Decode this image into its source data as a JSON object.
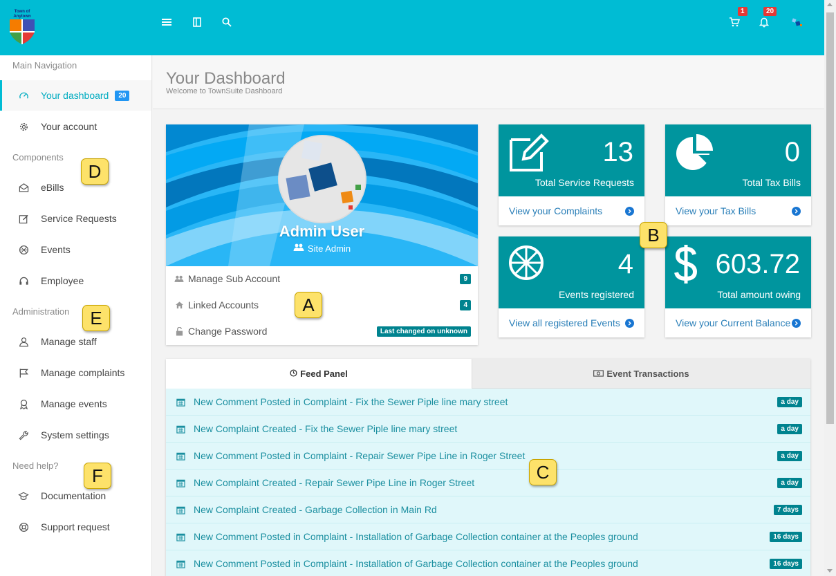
{
  "topbar": {
    "logo_text": "Town of Anytown",
    "cart_count": "1",
    "notification_count": "20"
  },
  "sidebar": {
    "sections": [
      {
        "heading": "Main Navigation",
        "items": [
          {
            "label": "Your dashboard",
            "badge": "20",
            "icon": "dashboard-icon",
            "active": true
          },
          {
            "label": "Your account",
            "icon": "gear-icon"
          }
        ]
      },
      {
        "heading": "Components",
        "items": [
          {
            "label": "eBills",
            "icon": "envelope-icon"
          },
          {
            "label": "Service Requests",
            "icon": "edit-icon"
          },
          {
            "label": "Events",
            "icon": "basketball-icon"
          },
          {
            "label": "Employee",
            "icon": "headset-icon"
          }
        ]
      },
      {
        "heading": "Administration",
        "items": [
          {
            "label": "Manage staff",
            "icon": "user-icon"
          },
          {
            "label": "Manage complaints",
            "icon": "flag-icon"
          },
          {
            "label": "Manage events",
            "icon": "award-icon"
          },
          {
            "label": "System settings",
            "icon": "wrench-icon"
          }
        ]
      },
      {
        "heading": "Need help?",
        "items": [
          {
            "label": "Documentation",
            "icon": "graduation-cap-icon"
          },
          {
            "label": "Support request",
            "icon": "lifebuoy-icon"
          }
        ]
      }
    ]
  },
  "markers": [
    "A",
    "B",
    "C",
    "D",
    "E",
    "F"
  ],
  "header": {
    "title": "Your Dashboard",
    "subtitle": "Welcome to TownSuite Dashboard"
  },
  "profile": {
    "name": "Admin User",
    "role": "Site Admin",
    "rows": [
      {
        "label": "Manage Sub Account",
        "count": "9"
      },
      {
        "label": "Linked Accounts",
        "count": "4"
      },
      {
        "label": "Change Password",
        "count": "Last changed on unknown"
      }
    ]
  },
  "stats": [
    {
      "number": "13",
      "label": "Total Service Requests",
      "link": "View your Complaints",
      "icon": "edit-icon"
    },
    {
      "number": "0",
      "label": "Total Tax Bills",
      "link": "View your Tax Bills",
      "icon": "pie-chart-icon"
    },
    {
      "number": "4",
      "label": "Events registered",
      "link": "View all registered Events",
      "icon": "basketball-icon"
    },
    {
      "number": "603.72",
      "label": "Total amount owing",
      "link": "View your Current Balance",
      "icon": "dollar-icon"
    }
  ],
  "feed": {
    "tabs": [
      "Feed Panel",
      "Event Transactions"
    ],
    "rows": [
      {
        "text": "New Comment Posted in Complaint - Fix the Sewer Piple line mary street",
        "age": "a day"
      },
      {
        "text": "New Complaint Created - Fix the Sewer Piple line mary street",
        "age": "a day"
      },
      {
        "text": "New Comment Posted in Complaint - Repair Sewer Pipe Line in Roger Street",
        "age": "a day"
      },
      {
        "text": "New Complaint Created - Repair Sewer Pipe Line in Roger Street",
        "age": "a day"
      },
      {
        "text": "New Complaint Created - Garbage Collection in Main Rd",
        "age": "7 days"
      },
      {
        "text": "New Comment Posted in Complaint - Installation of Garbage Collection container at the Peoples ground",
        "age": "16 days"
      },
      {
        "text": "New Comment Posted in Complaint - Installation of Garbage Collection container at the Peoples ground",
        "age": "16 days"
      }
    ]
  },
  "colors": {
    "topbar": "#00bcd4",
    "stat_card": "#00959e",
    "badge_dark": "#00838f",
    "badge_blue": "#2196f3",
    "badge_red": "#e53935",
    "feed_row": "#e0f7fa"
  }
}
